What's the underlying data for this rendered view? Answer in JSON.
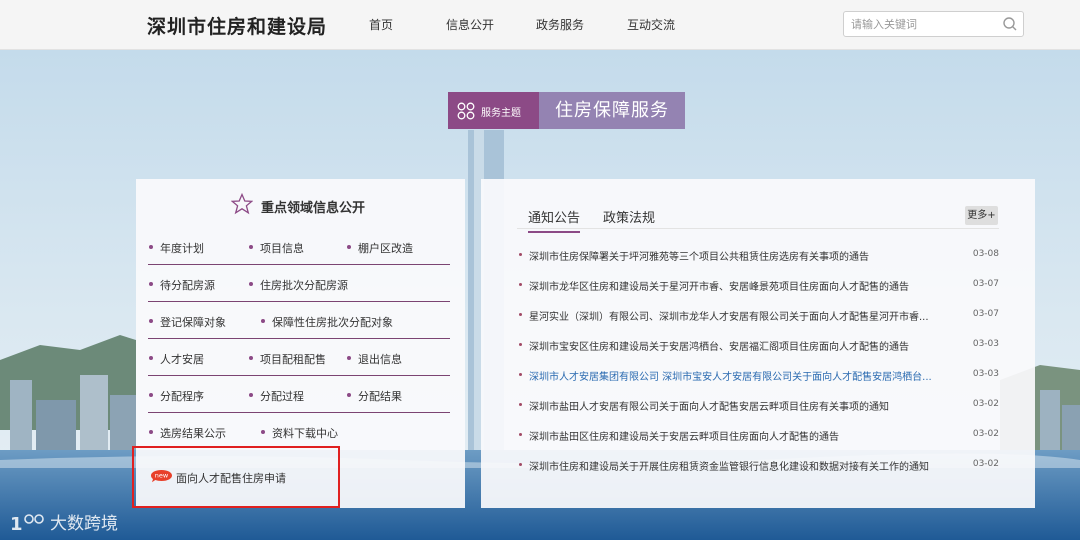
{
  "header": {
    "site_title": "深圳市住房和建设局",
    "nav": [
      "首页",
      "信息公开",
      "政务服务",
      "互动交流"
    ],
    "search": {
      "placeholder": "请输入关键词",
      "value": ""
    }
  },
  "banner": {
    "tag_label": "服务主题",
    "title": "住房保障服务"
  },
  "left_panel": {
    "title": "重点领域信息公开",
    "rows": [
      [
        "年度计划",
        "项目信息",
        "棚户区改造"
      ],
      [
        "待分配房源",
        "住房批次分配房源"
      ],
      [
        "登记保障对象",
        "保障性住房批次分配对象"
      ],
      [
        "人才安居",
        "项目配租配售",
        "退出信息"
      ],
      [
        "分配程序",
        "分配过程",
        "分配结果"
      ],
      [
        "选房结果公示",
        "资料下载中心"
      ]
    ],
    "featured": {
      "badge": "new",
      "label": "面向人才配售住房申请"
    }
  },
  "right_panel": {
    "tabs": [
      "通知公告",
      "政策法规"
    ],
    "active_tab": 0,
    "more_label": "更多+",
    "news": [
      {
        "title": "深圳市住房保障署关于坪河雅苑等三个项目公共租赁住房选房有关事项的通告",
        "date": "03-08"
      },
      {
        "title": "深圳市龙华区住房和建设局关于星河开市睿、安居峰景苑项目住房面向人才配售的通告",
        "date": "03-07"
      },
      {
        "title": "星河实业（深圳）有限公司、深圳市龙华人才安居有限公司关于面向人才配售星河开市睿...",
        "date": "03-07"
      },
      {
        "title": "深圳市宝安区住房和建设局关于安居鸿栖台、安居福汇阁项目住房面向人才配售的通告",
        "date": "03-03"
      },
      {
        "title": "深圳市人才安居集团有限公司 深圳市宝安人才安居有限公司关于面向人才配售安居鸿栖台...",
        "date": "03-03",
        "active": true
      },
      {
        "title": "深圳市盐田人才安居有限公司关于面向人才配售安居云畔项目住房有关事项的通知",
        "date": "03-02"
      },
      {
        "title": "深圳市盐田区住房和建设局关于安居云畔项目住房面向人才配售的通告",
        "date": "03-02"
      },
      {
        "title": "深圳市住房和建设局关于开展住房租赁资金监管银行信息化建设和数据对接有关工作的通知",
        "date": "03-02"
      }
    ]
  },
  "watermark": {
    "text": "大数跨境",
    "logo_mark": "1ᴼᴼ"
  },
  "colors": {
    "accent": "#8c4a86",
    "banner_title_bg": "#8c76aa",
    "link_active": "#2a6ab0",
    "highlight": "#e02020"
  }
}
